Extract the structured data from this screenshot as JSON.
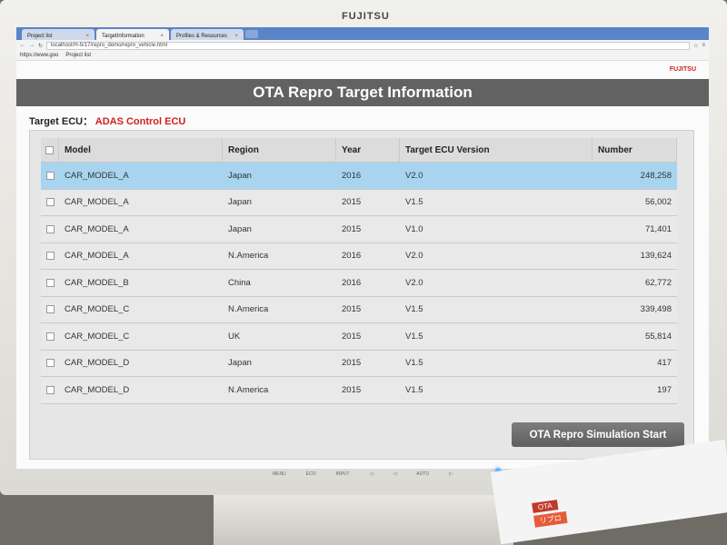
{
  "monitor": {
    "brand": "FUJITSU",
    "buttons": [
      "MENU",
      "ECO",
      "INPUT",
      "◁",
      "◁",
      "AUTO",
      "▷"
    ]
  },
  "browser": {
    "tabs": [
      {
        "label": "Project list",
        "active": false
      },
      {
        "label": "TargetInformation",
        "active": true
      },
      {
        "label": "Profiles & Resources",
        "active": false
      }
    ],
    "url": "localhost/H-5/17/repro_demo/repro_vehicle.html",
    "bookmarks": [
      "https://www.goo",
      "Project list"
    ]
  },
  "page": {
    "logo": "FUJITSU",
    "title": "OTA Repro Target Information",
    "target_label": "Target ECU：",
    "target_value": "ADAS Control ECU",
    "columns": [
      "Model",
      "Region",
      "Year",
      "Target ECU Version",
      "Number"
    ],
    "rows": [
      {
        "model": "CAR_MODEL_A",
        "region": "Japan",
        "year": "2016",
        "version": "V2.0",
        "number": "248,258",
        "selected": true
      },
      {
        "model": "CAR_MODEL_A",
        "region": "Japan",
        "year": "2015",
        "version": "V1.5",
        "number": "56,002",
        "selected": false
      },
      {
        "model": "CAR_MODEL_A",
        "region": "Japan",
        "year": "2015",
        "version": "V1.0",
        "number": "71,401",
        "selected": false
      },
      {
        "model": "CAR_MODEL_A",
        "region": "N.America",
        "year": "2016",
        "version": "V2.0",
        "number": "139,624",
        "selected": false
      },
      {
        "model": "CAR_MODEL_B",
        "region": "China",
        "year": "2016",
        "version": "V2.0",
        "number": "62,772",
        "selected": false
      },
      {
        "model": "CAR_MODEL_C",
        "region": "N.America",
        "year": "2015",
        "version": "V1.5",
        "number": "339,498",
        "selected": false
      },
      {
        "model": "CAR_MODEL_C",
        "region": "UK",
        "year": "2015",
        "version": "V1.5",
        "number": "55,814",
        "selected": false
      },
      {
        "model": "CAR_MODEL_D",
        "region": "Japan",
        "year": "2015",
        "version": "V1.5",
        "number": "417",
        "selected": false
      },
      {
        "model": "CAR_MODEL_D",
        "region": "N.America",
        "year": "2015",
        "version": "V1.5",
        "number": "197",
        "selected": false
      }
    ],
    "button_label": "OTA Repro Simulation Start"
  },
  "desk_flyer": {
    "chip1": "OTA",
    "chip2": "リプロ"
  },
  "colors": {
    "banner": "#626262",
    "selected_row": "#a8d4ef",
    "ecu_highlight": "#d01f1f",
    "tabbar": "#5a84c8"
  }
}
